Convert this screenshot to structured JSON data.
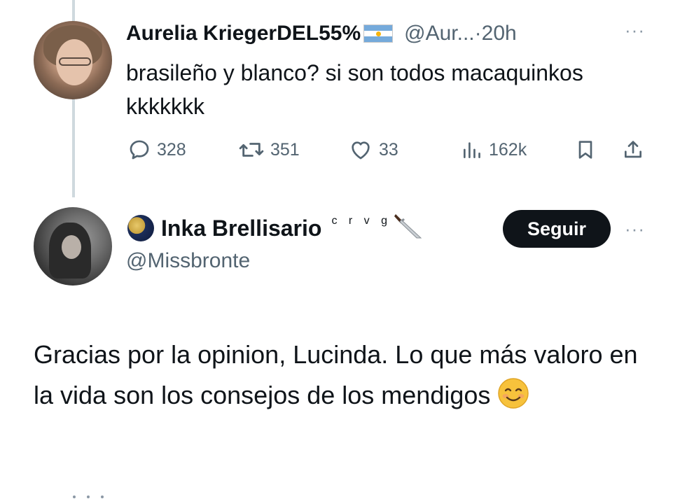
{
  "tweet1": {
    "author_name": "Aurelia KriegerDEL55%",
    "flag_icon": "argentina-flag-icon",
    "handle": "@Aur...",
    "separator": "·",
    "time": "20h",
    "more_label": "···",
    "text": "brasileño y blanco? si son todos macaquinkos kkkkkkk",
    "actions": {
      "replies": "328",
      "retweets": "351",
      "likes": "33",
      "views": "162k"
    }
  },
  "tweet2": {
    "author_name": "Inka Brellisario",
    "name_suffix": "c r v g",
    "name_icons": [
      "moon-icon",
      "knife-icon"
    ],
    "handle": "@Missbronte",
    "follow_label": "Seguir",
    "more_label": "···",
    "text": "Gracias por la opinion, Lucinda. Lo que más valoro en la vida son los consejos de los mendigos",
    "text_emoji": "smiling-face-icon"
  },
  "colors": {
    "text_primary": "#0f1419",
    "text_secondary": "#536471",
    "thread_line": "#cfd9de",
    "follow_bg": "#0f1419",
    "follow_text": "#ffffff"
  }
}
